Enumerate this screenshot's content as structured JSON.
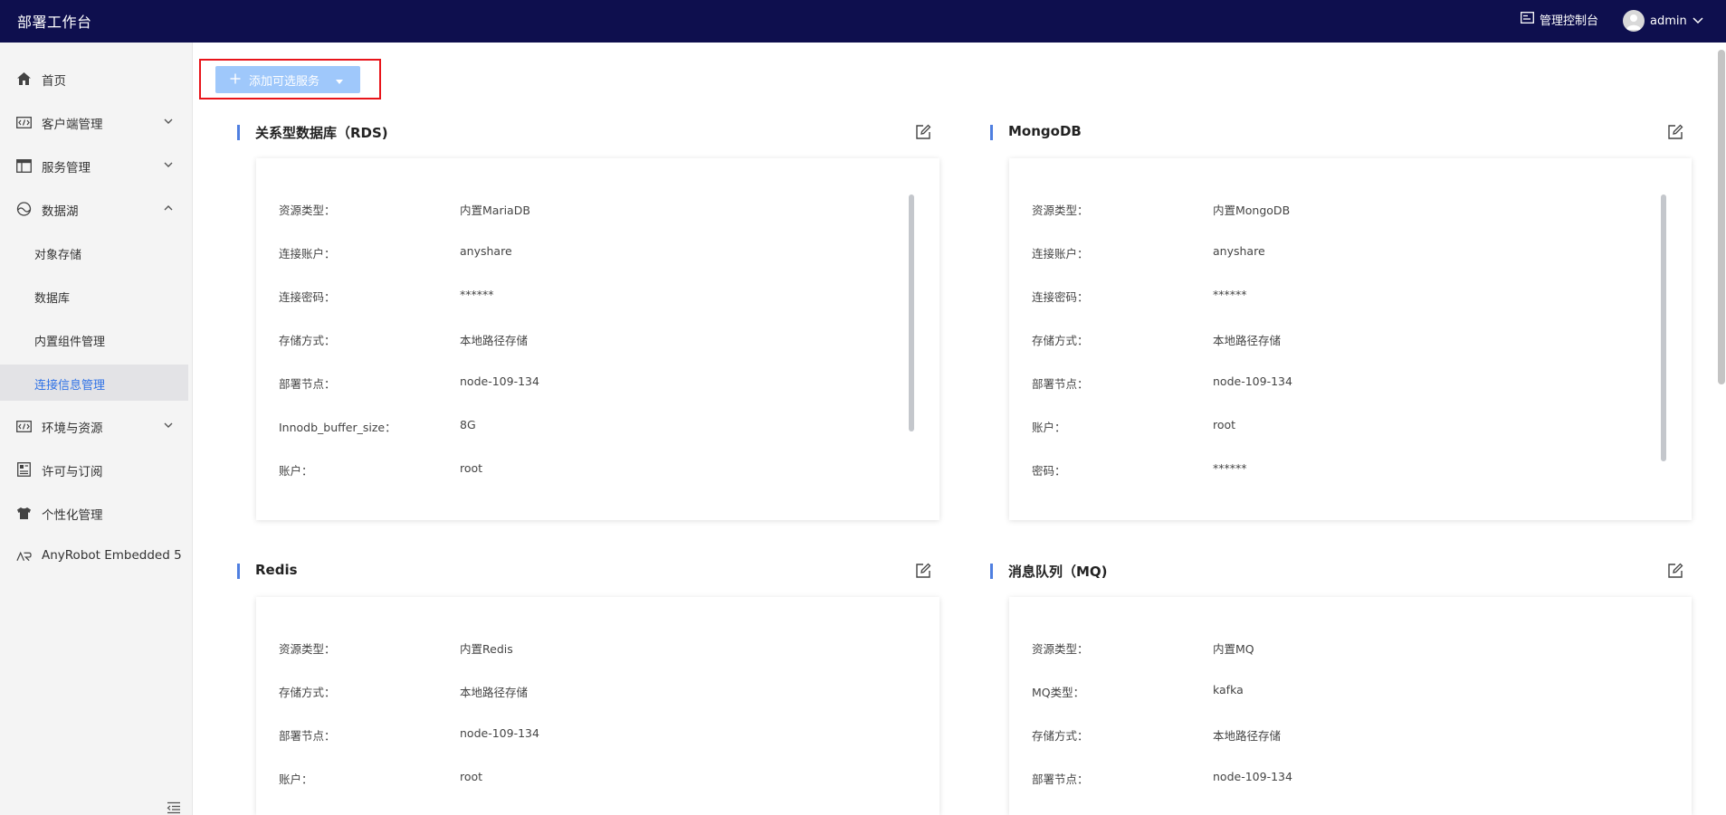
{
  "app": {
    "title": "部署工作台",
    "console_label": "管理控制台",
    "user_name": "admin"
  },
  "sidebar": {
    "items": [
      {
        "label": "首页",
        "icon": "home-icon"
      },
      {
        "label": "客户端管理",
        "icon": "client-code-icon",
        "chevron": "down"
      },
      {
        "label": "服务管理",
        "icon": "service-table-icon",
        "chevron": "down"
      },
      {
        "label": "数据湖",
        "icon": "datalake-icon",
        "chevron": "up"
      },
      {
        "label": "对象存储"
      },
      {
        "label": "数据库"
      },
      {
        "label": "内置组件管理"
      },
      {
        "label": "连接信息管理",
        "active": true
      },
      {
        "label": "环境与资源",
        "icon": "environment-code-icon",
        "chevron": "down"
      },
      {
        "label": "许可与订阅",
        "icon": "license-icon"
      },
      {
        "label": "个性化管理",
        "icon": "tshirt-icon"
      },
      {
        "label": "AnyRobot Embedded 5",
        "icon": "anyrobot-icon"
      }
    ]
  },
  "toolbar": {
    "add_service_label": "添加可选服务"
  },
  "sections": [
    {
      "title": "关系型数据库（RDS)",
      "rows": [
        {
          "label": "资源类型：",
          "value": "内置MariaDB"
        },
        {
          "label": "连接账户：",
          "value": "anyshare"
        },
        {
          "label": "连接密码：",
          "value": "******"
        },
        {
          "label": "存储方式：",
          "value": "本地路径存储"
        },
        {
          "label": "部署节点：",
          "value": "node-109-134"
        },
        {
          "label": "Innodb_buffer_size：",
          "value": "8G"
        },
        {
          "label": "账户：",
          "value": "root"
        }
      ]
    },
    {
      "title": "MongoDB",
      "rows": [
        {
          "label": "资源类型：",
          "value": "内置MongoDB"
        },
        {
          "label": "连接账户：",
          "value": "anyshare"
        },
        {
          "label": "连接密码：",
          "value": "******"
        },
        {
          "label": "存储方式：",
          "value": "本地路径存储"
        },
        {
          "label": "部署节点：",
          "value": "node-109-134"
        },
        {
          "label": "账户：",
          "value": "root"
        },
        {
          "label": "密码：",
          "value": "******"
        }
      ]
    },
    {
      "title": "Redis",
      "rows": [
        {
          "label": "资源类型：",
          "value": "内置Redis"
        },
        {
          "label": "存储方式：",
          "value": "本地路径存储"
        },
        {
          "label": "部署节点：",
          "value": "node-109-134"
        },
        {
          "label": "账户：",
          "value": "root"
        }
      ]
    },
    {
      "title": "消息队列（MQ)",
      "rows": [
        {
          "label": "资源类型：",
          "value": "内置MQ"
        },
        {
          "label": "MQ类型：",
          "value": "kafka"
        },
        {
          "label": "存储方式：",
          "value": "本地路径存储"
        },
        {
          "label": "部署节点：",
          "value": "node-109-134"
        }
      ]
    }
  ],
  "colors": {
    "topbar": "#0e0f4e",
    "accent": "#2f72e6",
    "section_bar": "#4f7fe0",
    "add_button": "#9fc8fb",
    "highlight_border": "#e8141a"
  }
}
